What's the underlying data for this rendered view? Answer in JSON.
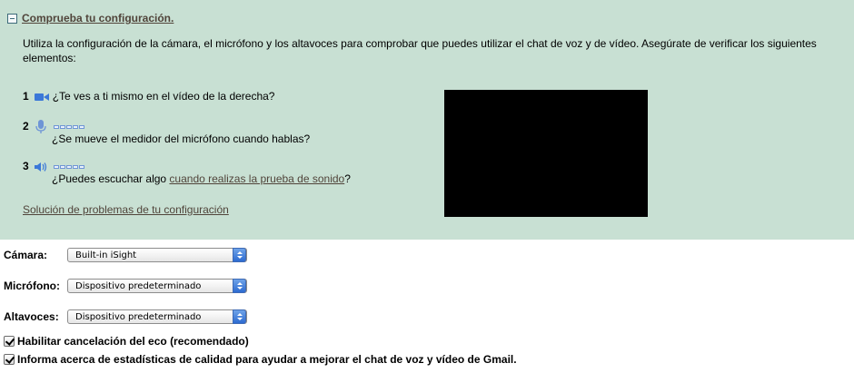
{
  "panel": {
    "header_link": "Comprueba tu configuración.",
    "intro": "Utiliza la configuración de la cámara, el micrófono y los altavoces para comprobar que puedes utilizar el chat de voz y de vídeo. Asegúrate de verificar los siguientes elementos:",
    "steps": [
      {
        "num": "1",
        "icon": "video-camera-icon",
        "text": "¿Te ves a ti mismo en el vídeo de la derecha?"
      },
      {
        "num": "2",
        "icon": "microphone-icon",
        "text": "¿Se mueve el medidor del micrófono cuando hablas?"
      },
      {
        "num": "3",
        "icon": "speaker-icon",
        "text_before": "¿Puedes escuchar algo ",
        "link": "cuando realizas la prueba de sonido",
        "text_after": "?"
      }
    ],
    "troubleshoot_link": "Solución de problemas de tu configuración"
  },
  "settings": {
    "camera": {
      "label": "Cámara:",
      "value": "Built-in iSight"
    },
    "microphone": {
      "label": "Micrófono:",
      "value": "Dispositivo predeterminado"
    },
    "speakers": {
      "label": "Altavoces:",
      "value": "Dispositivo predeterminado"
    }
  },
  "options": {
    "echo_cancel": {
      "label": "Habilitar cancelación del eco (recomendado)",
      "checked": true
    },
    "quality_stats": {
      "label": "Informa acerca de estadísticas de calidad para ayudar a mejorar el chat de voz y vídeo de Gmail.",
      "checked": true
    }
  },
  "colors": {
    "panel_bg": "#c8e0d3",
    "link": "#50443a",
    "icon_blue": "#3b78d8"
  }
}
